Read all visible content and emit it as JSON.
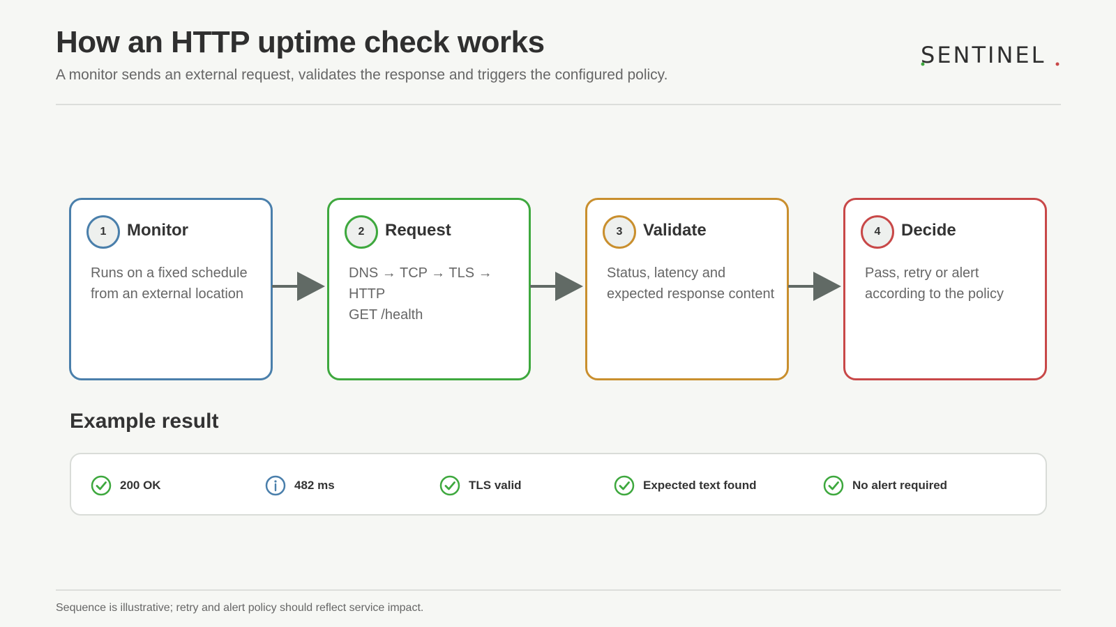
{
  "header": {
    "title": "How an HTTP uptime check works",
    "subtitle": "A monitor sends an external request, validates the response and triggers the configured policy.",
    "logo_text": "SENTINEL"
  },
  "colors": {
    "monitor": "#4a7fab",
    "request": "#3ea83e",
    "validate": "#c98f2e",
    "decide": "#c84848",
    "arrow": "#616a65",
    "check": "#3ea83e",
    "info": "#4a7fab",
    "logo_green": "#3ea83e",
    "logo_red": "#c84848"
  },
  "steps": [
    {
      "number": "1",
      "label": "Monitor",
      "desc_lines": [
        "Runs on a fixed schedule",
        "from an external location"
      ]
    },
    {
      "number": "2",
      "label": "Request",
      "desc_lines": [
        "DNS → TCP → TLS → HTTP",
        "GET /health"
      ]
    },
    {
      "number": "3",
      "label": "Validate",
      "desc_lines": [
        "Status, latency and",
        "expected response content"
      ]
    },
    {
      "number": "4",
      "label": "Decide",
      "desc_lines": [
        "Pass, retry or alert",
        "according to the policy"
      ]
    }
  ],
  "example": {
    "title": "Example result",
    "results": [
      {
        "icon": "check-circle-icon",
        "text": "200 OK"
      },
      {
        "icon": "info-circle-icon",
        "text": "482 ms"
      },
      {
        "icon": "check-circle-icon",
        "text": "TLS valid"
      },
      {
        "icon": "check-circle-icon",
        "text": "Expected text found"
      },
      {
        "icon": "check-circle-icon",
        "text": "No alert required"
      }
    ]
  },
  "footnote": "Sequence is illustrative; retry and alert policy should reflect service impact."
}
